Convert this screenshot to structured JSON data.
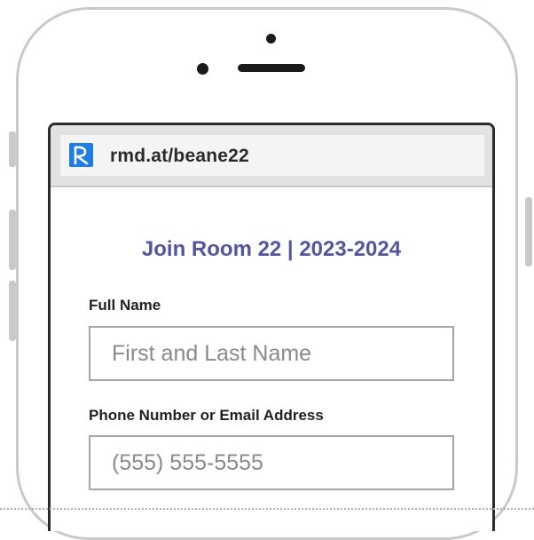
{
  "browser": {
    "url": "rmd.at/beane22",
    "logo_icon": "remind-logo-icon"
  },
  "form": {
    "title": "Join Room 22 | 2023-2024",
    "full_name": {
      "label": "Full Name",
      "placeholder": "First and Last Name",
      "value": ""
    },
    "contact": {
      "label": "Phone Number or Email Address",
      "placeholder": "(555) 555-5555",
      "value": ""
    }
  },
  "colors": {
    "title": "#55559d",
    "logo_bg": "#1e7ee6",
    "frame": "#c9c9c9",
    "screen_border": "#2b2b2b"
  }
}
